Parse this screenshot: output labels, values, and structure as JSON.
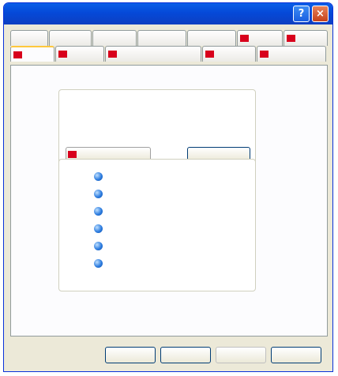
{
  "window": {
    "title": "",
    "help_label": "?",
    "close_label": "×"
  },
  "tabs": {
    "back_row": [
      {
        "label": ""
      },
      {
        "label": ""
      },
      {
        "label": ""
      },
      {
        "label": ""
      },
      {
        "label": ""
      },
      {
        "label": ""
      },
      {
        "label": ""
      }
    ],
    "front_row": [
      {
        "label": ""
      },
      {
        "label": ""
      },
      {
        "label": ""
      },
      {
        "label": ""
      },
      {
        "label": ""
      }
    ]
  },
  "info": {
    "title": "",
    "rows": [
      {
        "label": "",
        "value": ""
      },
      {
        "label": "",
        "value": ""
      },
      {
        "label": "",
        "value": ""
      }
    ],
    "extra_value": "",
    "ati_button_label": "",
    "detail_button_label": ""
  },
  "features": {
    "items": [
      {
        "label": "",
        "icon": "blue-orb-icon"
      },
      {
        "label": "",
        "icon": "blue-orb-icon"
      },
      {
        "label": "",
        "icon": "blue-orb-icon"
      },
      {
        "label": "",
        "icon": "blue-orb-icon"
      },
      {
        "label": "",
        "icon": "blue-orb-icon"
      },
      {
        "label": "",
        "icon": "blue-orb-icon"
      }
    ]
  },
  "footer": {
    "ok_label": "",
    "cancel_label": "",
    "apply_label": "",
    "help_label": ""
  },
  "colors": {
    "titlebar": "#0549d8",
    "ati_red": "#d8001c",
    "dialog_bg": "#ece9d8"
  }
}
